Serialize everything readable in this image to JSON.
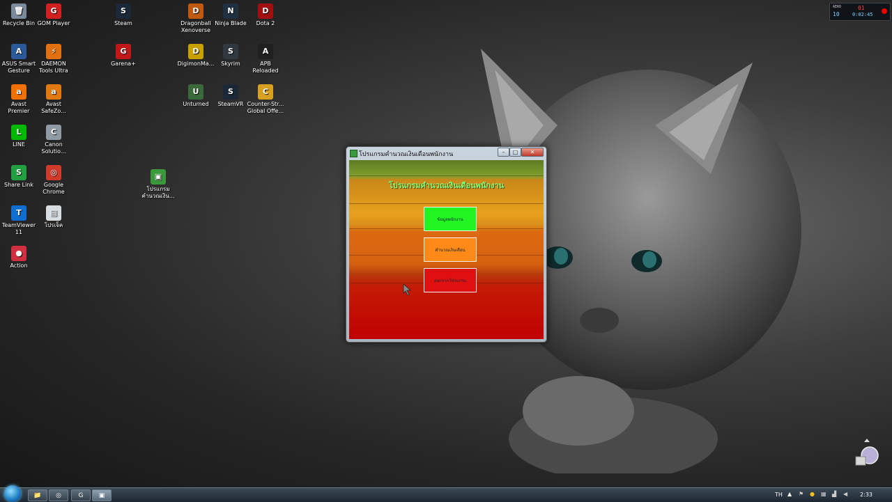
{
  "desktop_icons": [
    {
      "label": "Recycle Bin",
      "glyph": "🗑",
      "color": "#7a8a9a"
    },
    {
      "label": "GOM Player",
      "glyph": "G",
      "color": "#d02020"
    },
    {
      "label": "Steam",
      "glyph": "S",
      "color": "#1b2838"
    },
    {
      "label": "Dragonball Xenoverse",
      "glyph": "D",
      "color": "#c05a10"
    },
    {
      "label": "Ninja Blade",
      "glyph": "N",
      "color": "#203040"
    },
    {
      "label": "Dota 2",
      "glyph": "D",
      "color": "#a01010"
    },
    {
      "label": "ASUS Smart Gesture",
      "glyph": "A",
      "color": "#2a5a9a"
    },
    {
      "label": "DAEMON Tools Ultra",
      "glyph": "⚡",
      "color": "#e07010"
    },
    {
      "label": "Garena+",
      "glyph": "G",
      "color": "#c01818"
    },
    {
      "label": "DigimonMa...",
      "glyph": "D",
      "color": "#c8a000"
    },
    {
      "label": "Skyrim",
      "glyph": "S",
      "color": "#303840"
    },
    {
      "label": "APB Reloaded",
      "glyph": "A",
      "color": "#202020"
    },
    {
      "label": "Avast Premier",
      "glyph": "a",
      "color": "#f07000"
    },
    {
      "label": "Avast SafeZo...",
      "glyph": "a",
      "color": "#e07a10"
    },
    {
      "label": "Unturned",
      "glyph": "U",
      "color": "#3a6a3a"
    },
    {
      "label": "SteamVR",
      "glyph": "S",
      "color": "#1b2838"
    },
    {
      "label": "Counter-Str... Global Offe...",
      "glyph": "C",
      "color": "#d8a020"
    },
    {
      "label": "LINE",
      "glyph": "L",
      "color": "#00b900"
    },
    {
      "label": "Canon Solutio...",
      "glyph": "C",
      "color": "#909aa4"
    },
    {
      "label": "Share Link",
      "glyph": "S",
      "color": "#20a040"
    },
    {
      "label": "Google Chrome",
      "glyph": "◎",
      "color": "#d03a2a"
    },
    {
      "label": "โปรแกรม คำนวณเงิน...",
      "glyph": "▣",
      "color": "#3a9a3a"
    },
    {
      "label": "TeamViewer 11",
      "glyph": "T",
      "color": "#0e6fd1"
    },
    {
      "label": "โปรเจ็ค",
      "glyph": "▤",
      "color": "#d8dde2"
    },
    {
      "label": "Action",
      "glyph": "●",
      "color": "#d03040"
    }
  ],
  "window": {
    "title": "โปรแกรมคำนวณเงินเดือนพนักงาน",
    "minimize_glyph": "–",
    "maximize_glyph": "□",
    "close_glyph": "✕",
    "heading": "โปรแกรมคำนวณเงินเดือนพนักงาน",
    "buttons": [
      {
        "label": "ข้อมูลพนักงาน",
        "bg": "#22f522"
      },
      {
        "label": "คำนวณเงินเดือน",
        "bg": "#ff8a18"
      },
      {
        "label": "ออกจากโปรแกรม",
        "bg": "#e01010"
      }
    ]
  },
  "taskbar": {
    "buttons": [
      "📁",
      "◎",
      "G",
      "▣"
    ],
    "language": "TH",
    "clock": "2:33"
  },
  "fps_overlay": {
    "top_left": "AERO",
    "bottom_left": "10",
    "top_right": "01",
    "bottom_right": "0:02:45"
  }
}
